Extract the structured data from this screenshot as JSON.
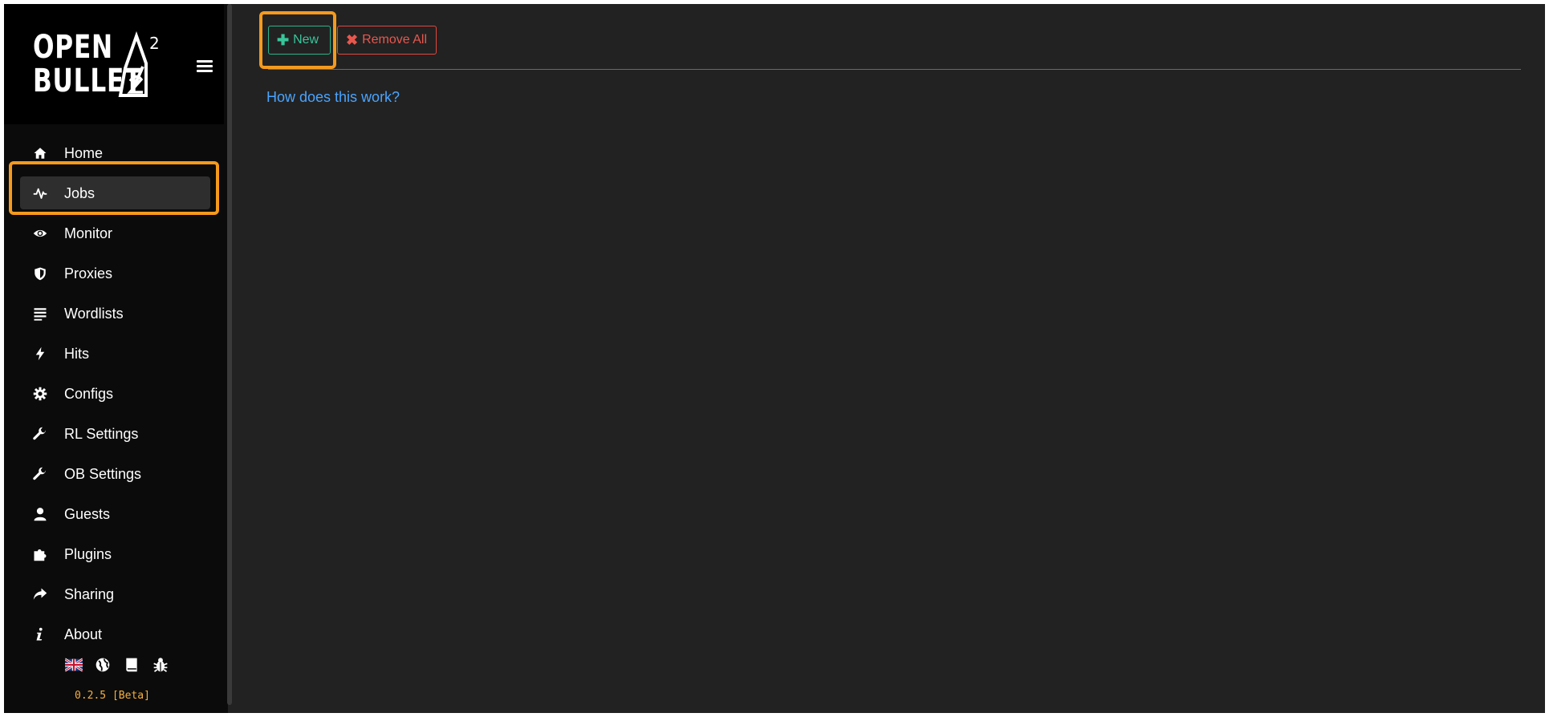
{
  "brand": {
    "line1": "OPEN",
    "line2": "BULLET",
    "superscript": "2"
  },
  "sidebar": {
    "items": [
      {
        "label": "Home",
        "icon": "home-icon"
      },
      {
        "label": "Jobs",
        "icon": "activity-icon",
        "active": true
      },
      {
        "label": "Monitor",
        "icon": "eye-icon"
      },
      {
        "label": "Proxies",
        "icon": "shield-icon"
      },
      {
        "label": "Wordlists",
        "icon": "lines-icon"
      },
      {
        "label": "Hits",
        "icon": "bolt-icon"
      },
      {
        "label": "Configs",
        "icon": "gear-icon"
      },
      {
        "label": "RL Settings",
        "icon": "wrench-icon"
      },
      {
        "label": "OB Settings",
        "icon": "wrench-icon"
      },
      {
        "label": "Guests",
        "icon": "user-icon"
      },
      {
        "label": "Plugins",
        "icon": "puzzle-icon"
      },
      {
        "label": "Sharing",
        "icon": "share-icon"
      },
      {
        "label": "About",
        "icon": "info-icon"
      }
    ],
    "footer_icons": [
      "uk-flag-icon",
      "globe-icon",
      "book-icon",
      "bug-icon"
    ],
    "version": "0.2.5 [Beta]"
  },
  "toolbar": {
    "new_label": "New",
    "remove_all_label": "Remove All"
  },
  "main": {
    "help_link": "How does this work?"
  },
  "colors": {
    "accent_highlight": "#f59a1e",
    "new_button": "#39c59a",
    "remove_button": "#e8574e",
    "link": "#4aa4ff",
    "version": "#f6b042"
  }
}
